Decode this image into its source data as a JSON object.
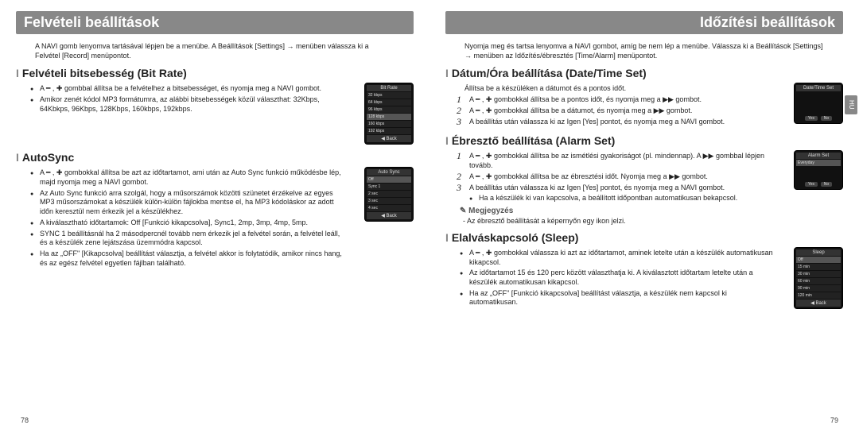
{
  "left": {
    "header": "Felvételi beállítások",
    "intro": "A NAVI gomb lenyomva tartásával lépjen be a menübe. A Beállítások [Settings] → menüben válassza ki a Felvétel [Record] menüpontot.",
    "sec1": {
      "title": "Felvételi bitsebesség (Bit Rate)",
      "b1": "A ━ , ✚ gombbal állítsa be a felvételhez a bitsebességet, és nyomja meg a NAVI gombot.",
      "b2": "Amikor zenét kódol MP3 formátumra, az alábbi bitsebességek közül választhat: 32Kbps, 64Kbkps, 96Kbps, 128Kbps, 160kbps, 192kbps.",
      "shot": {
        "title": "Bit Rate",
        "r1": "32 kbps",
        "r2": "64 kbps",
        "r3": "96 kbps",
        "r4": "128 kbps",
        "r5": "160 kbps",
        "r6": "192 kbps",
        "back": "◀ Back"
      }
    },
    "sec2": {
      "title": "AutoSync",
      "b1": "A ━ , ✚ gombokkal állítsa be azt az időtartamot, ami után az Auto Sync funkció működésbe lép, majd nyomja meg a NAVI gombot.",
      "b2": "Az Auto Sync funkció arra szolgál, hogy a műsorszámok közötti szünetet érzékelve az egyes MP3 műsorszámokat a készülék külön-külön fájlokba mentse el, ha MP3 kódoláskor az adott időn keresztül nem érkezik jel a készülékhez.",
      "b3": "A kiválasztható időtartamok: Off [Funkció kikapcsolva], Sync1, 2mp, 3mp, 4mp, 5mp.",
      "b4": "SYNC 1 beállításnál ha 2 másodpercnél tovább nem érkezik jel a felvétel során, a felvétel leáll, és a készülék zene lejátszása üzemmódra kapcsol.",
      "b5": "Ha az „OFF\" [Kikapcsolva] beállítást választja, a felvétel akkor is folytatódik, amikor nincs hang, és az egész felvétel egyetlen fájlban található.",
      "shot": {
        "title": "Auto Sync",
        "r1": "Off",
        "r2": "Sync 1",
        "r3": "2 sec",
        "r4": "3 sec",
        "r5": "4 sec",
        "back": "◀ Back"
      }
    },
    "pnum": "78"
  },
  "right": {
    "header": "Időzítési beállítások",
    "intro": "Nyomja meg és tartsa lenyomva a NAVI gombot, amíg be nem lép a menübe. Válassza ki a Beállítások [Settings] → menüben az Időzítés/ébresztés [Time/Alarm] menüpontot.",
    "sec1": {
      "title": "Dátum/Óra beállítása (Date/Time Set)",
      "sub": "Állítsa be a készüléken a dátumot és a pontos időt.",
      "n1": "A ━ , ✚ gombokkal állítsa be a pontos időt, és nyomja meg a ▶▶ gombot.",
      "n2": "A ━ , ✚ gombokkal állítsa be a dátumot, és nyomja meg a ▶▶ gombot.",
      "n3": "A beállítás után válassza ki az Igen [Yes] pontot, és nyomja meg a NAVI gombot.",
      "shot": {
        "title": "Date/Time Set",
        "yes": "Yes",
        "no": "No"
      }
    },
    "sec2": {
      "title": "Ébresztő beállítása (Alarm Set)",
      "n1": "A ━ , ✚ gombokkal állítsa be az ismétlési gyakoriságot (pl. mindennap). A ▶▶ gombbal lépjen tovább.",
      "n2": "A ━ , ✚ gombokkal állítsa be az ébresztési időt. Nyomja meg a ▶▶ gombot.",
      "n3": "A beállítás után válassza ki az Igen [Yes] pontot, és nyomja meg a NAVI gombot.",
      "n3b": "Ha a készülék ki van kapcsolva, a beállított időpontban automatikusan bekapcsol.",
      "note_h": "Megjegyzés",
      "note": "- Az ébresztő beállítását a képernyőn egy ikon jelzi.",
      "shot": {
        "title": "Alarm Set",
        "r1": "Everyday",
        "yes": "Yes",
        "no": "No"
      }
    },
    "sec3": {
      "title": "Elalváskapcsoló (Sleep)",
      "b1": "A ━ , ✚ gombokkal válassza ki azt az időtartamot, aminek letelte után a készülék automatikusan kikapcsol.",
      "b2": "Az időtartamot 15 és 120 perc között választhatja ki. A kiválasztott időtartam letelte után a készülék automatikusan kikapcsol.",
      "b3": "Ha az „OFF\" [Funkció kikapcsolva] beállítást választja, a készülék nem kapcsol ki automatikusan.",
      "shot": {
        "title": "Sleep",
        "r1": "Off",
        "r2": "15 min",
        "r3": "30 min",
        "r4": "60 min",
        "r5": "90 min",
        "r6": "120 min",
        "back": "◀ Back"
      }
    },
    "pnum": "79",
    "sidetab": "HU"
  }
}
